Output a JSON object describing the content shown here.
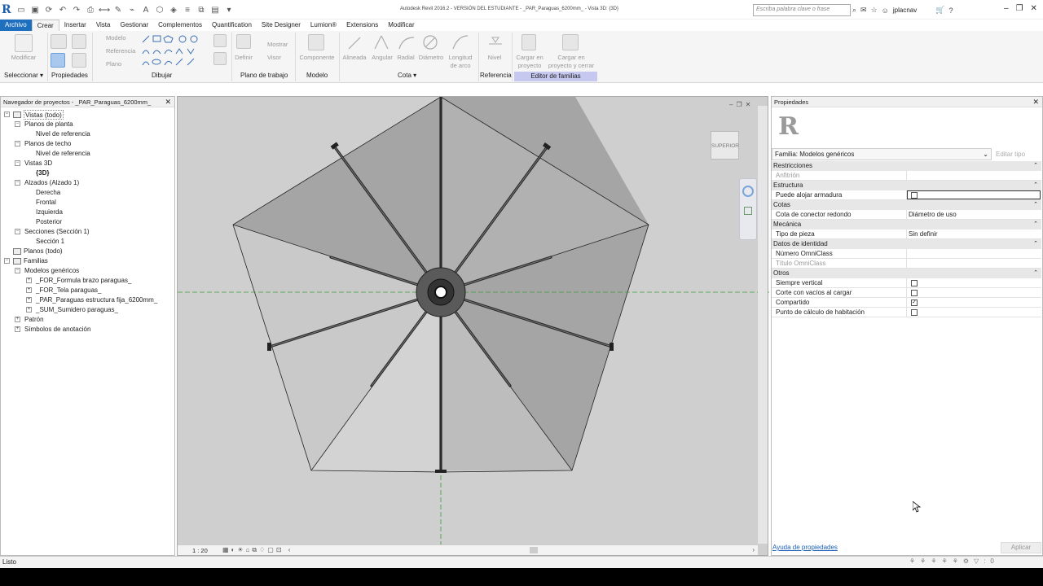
{
  "window": {
    "title": "Autodesk Revit 2016.2 - VERSIÓN DEL ESTUDIANTE -  _PAR_Paraguas_6200mm_ - Vista 3D: {3D}",
    "search_placeholder": "Escriba palabra clave o frase",
    "user": "jplacnav"
  },
  "tabs": [
    {
      "label": "Archivo"
    },
    {
      "label": "Crear"
    },
    {
      "label": "Insertar"
    },
    {
      "label": "Vista"
    },
    {
      "label": "Gestionar"
    },
    {
      "label": "Complementos"
    },
    {
      "label": "Quantification"
    },
    {
      "label": "Site Designer"
    },
    {
      "label": "Lumion®"
    },
    {
      "label": "Extensions"
    },
    {
      "label": "Modificar"
    }
  ],
  "ribbon": {
    "modificar": "Modificar",
    "modelo": "Modelo",
    "referencia": "Referencia",
    "plano": "Plano",
    "definir": "Definir",
    "mostrar": "Mostrar",
    "visor": "Visor",
    "componente": "Componente",
    "alineada": "Alineada",
    "angular": "Angular",
    "radial": "Radial",
    "diametro": "Diámetro",
    "longitud": "Longitud",
    "de_arco": "de arco",
    "nivel": "Nivel",
    "cargar_en": "Cargar en",
    "proyecto": "proyecto",
    "cargar_en2": "Cargar en",
    "proyecto_cerrar": "proyecto y cerrar",
    "panels": {
      "seleccionar": "Seleccionar ▾",
      "propiedades": "Propiedades",
      "dibujar": "Dibujar",
      "plano_trabajo": "Plano de trabajo",
      "modelo": "Modelo",
      "cota": "Cota ▾",
      "referencia": "Referencia",
      "editor_familias": "Editor de familias"
    }
  },
  "browser": {
    "title": "Navegador de proyectos - _PAR_Paraguas_6200mm_",
    "items": [
      {
        "label": "Vistas (todo)",
        "level": 0,
        "exp": "−"
      },
      {
        "label": "Planos de planta",
        "level": 1,
        "exp": "−"
      },
      {
        "label": "Nivel de referencia",
        "level": 2,
        "exp": ""
      },
      {
        "label": "Planos de techo",
        "level": 1,
        "exp": "−"
      },
      {
        "label": "Nivel de referencia",
        "level": 2,
        "exp": ""
      },
      {
        "label": "Vistas 3D",
        "level": 1,
        "exp": "−"
      },
      {
        "label": "{3D}",
        "level": 2,
        "exp": "",
        "bold": true
      },
      {
        "label": "Alzados (Alzado 1)",
        "level": 1,
        "exp": "−"
      },
      {
        "label": "Derecha",
        "level": 2,
        "exp": ""
      },
      {
        "label": "Frontal",
        "level": 2,
        "exp": ""
      },
      {
        "label": "Izquierda",
        "level": 2,
        "exp": ""
      },
      {
        "label": "Posterior",
        "level": 2,
        "exp": ""
      },
      {
        "label": "Secciones (Sección 1)",
        "level": 1,
        "exp": "−"
      },
      {
        "label": "Sección 1",
        "level": 2,
        "exp": ""
      },
      {
        "label": "Planos (todo)",
        "level": 0,
        "exp": ""
      },
      {
        "label": "Familias",
        "level": 0,
        "exp": "−"
      },
      {
        "label": "Modelos genéricos",
        "level": 1,
        "exp": "−"
      },
      {
        "label": "_FOR_Formula brazo paraguas_",
        "level": 2,
        "exp": "+"
      },
      {
        "label": "_FOR_Tela paraguas_",
        "level": 2,
        "exp": "+"
      },
      {
        "label": "_PAR_Paraguas estructura fija_6200mm_",
        "level": 2,
        "exp": "+"
      },
      {
        "label": "_SUM_Sumidero paraguas_",
        "level": 2,
        "exp": "+"
      },
      {
        "label": "Patrón",
        "level": 1,
        "exp": "+"
      },
      {
        "label": "Símbolos de anotación",
        "level": 1,
        "exp": "+"
      }
    ]
  },
  "viewport": {
    "viewcube_label": "SUPERIOR",
    "scale": "1 : 20"
  },
  "properties": {
    "title": "Propiedades",
    "type_selector": "Familia: Modelos genéricos",
    "edit_type": "Editar tipo",
    "groups": [
      {
        "name": "Restricciones",
        "rows": [
          {
            "key": "Anfitrión",
            "value": "",
            "disabled": true
          }
        ]
      },
      {
        "name": "Estructura",
        "rows": [
          {
            "key": "Puede alojar armadura",
            "check": false,
            "selected": true
          }
        ]
      },
      {
        "name": "Cotas",
        "rows": [
          {
            "key": "Cota de conector redondo",
            "value": "Diámetro de uso"
          }
        ]
      },
      {
        "name": "Mecánica",
        "rows": [
          {
            "key": "Tipo de pieza",
            "value": "Sin definir"
          }
        ]
      },
      {
        "name": "Datos de identidad",
        "rows": [
          {
            "key": "Número OmniClass",
            "value": ""
          },
          {
            "key": "Título OmniClass",
            "value": "",
            "disabled": true
          }
        ]
      },
      {
        "name": "Otros",
        "rows": [
          {
            "key": "Siempre vertical",
            "check": false
          },
          {
            "key": "Corte con vacíos al cargar",
            "check": false
          },
          {
            "key": "Compartido",
            "check": true
          },
          {
            "key": "Punto de cálculo de habitación",
            "check": false
          }
        ]
      }
    ],
    "help_link": "Ayuda de propiedades",
    "apply": "Aplicar"
  },
  "status": {
    "text": "Listo",
    "filter_count": ":0"
  },
  "colors": {
    "file_tab": "#1f6fbf",
    "family_editor_panel": "#c6c8f0",
    "viewport_bg": "#cfcfcf",
    "reference_line": "#3c9a3c"
  }
}
